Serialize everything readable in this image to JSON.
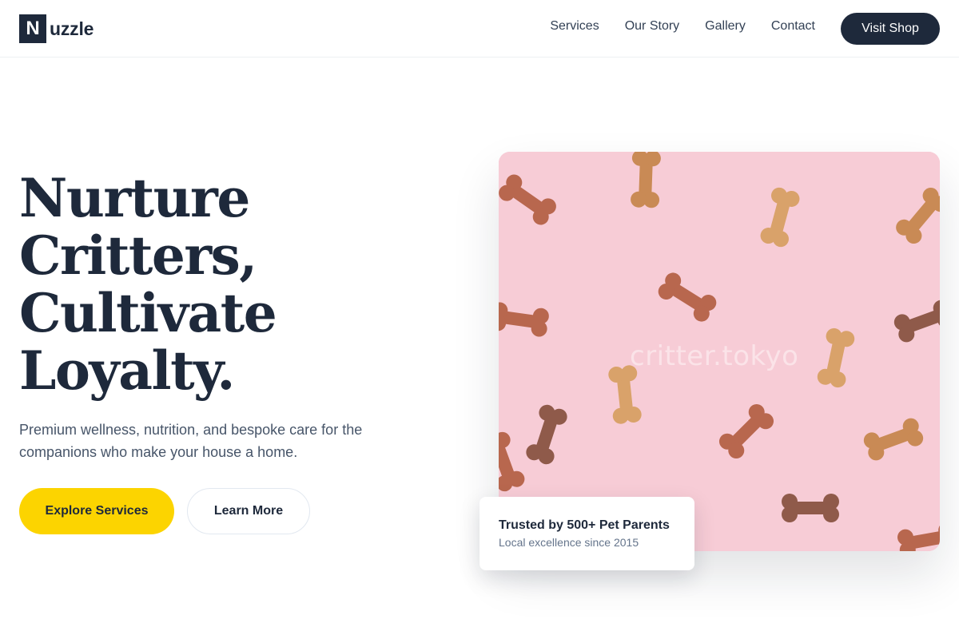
{
  "brand": {
    "mark": "N",
    "name": "uzzle"
  },
  "nav": {
    "items": [
      {
        "label": "Services"
      },
      {
        "label": "Our Story"
      },
      {
        "label": "Gallery"
      },
      {
        "label": "Contact"
      }
    ],
    "cta": "Visit Shop"
  },
  "hero": {
    "title_lines": [
      "Nurture",
      "Critters,",
      "Cultivate",
      "Loyalty."
    ],
    "subtitle": "Premium wellness, nutrition, and bespoke care for the companions who make your house a home.",
    "primary_button": "Explore Services",
    "secondary_button": "Learn More",
    "image_watermark": "critter.tokyo"
  },
  "trust_card": {
    "title": "Trusted by 500+ Pet Parents",
    "subtitle": "Local excellence since 2015"
  },
  "colors": {
    "brand_dark": "#1e293b",
    "accent_yellow": "#fcd400",
    "image_background": "#f7ccd6",
    "biscuit_colors": [
      "#c98a55",
      "#b8674e",
      "#8f5a4a",
      "#d9a26a"
    ]
  },
  "icons": {
    "logo": "logo-mark",
    "image_content": "dog-bone-biscuits"
  }
}
